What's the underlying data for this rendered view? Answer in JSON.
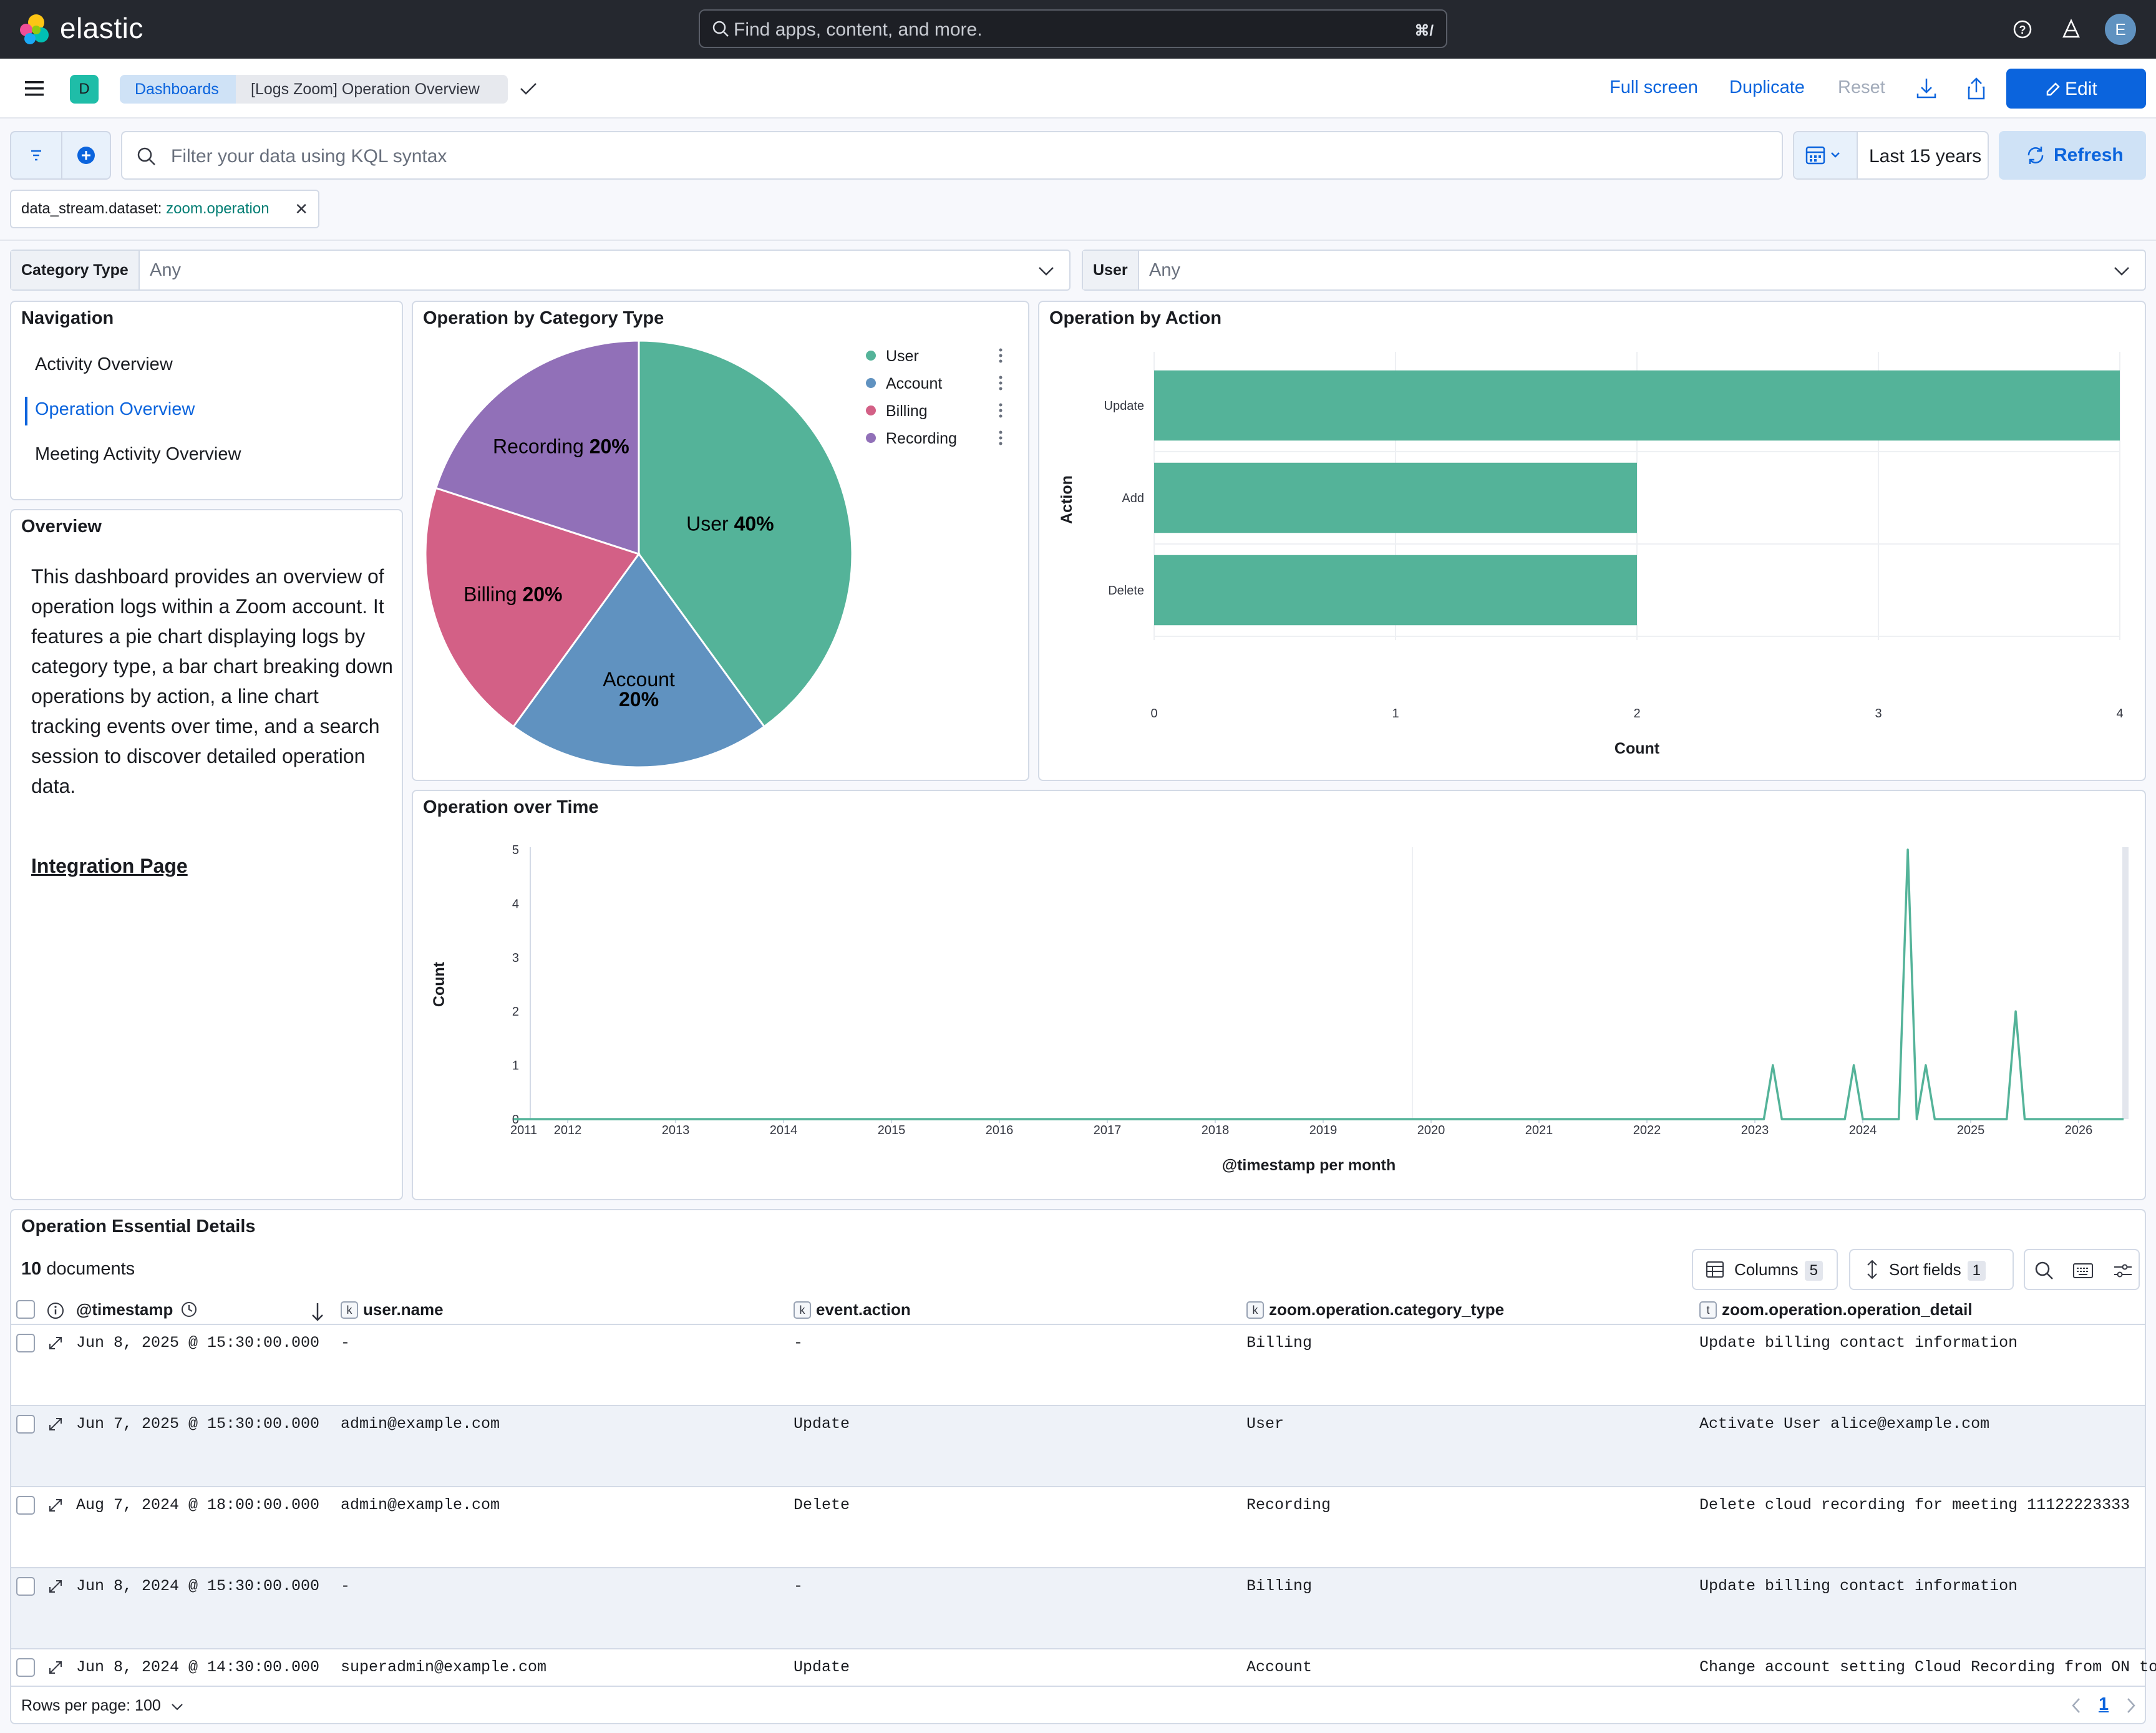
{
  "app": {
    "brand": "elastic",
    "search_placeholder": "Find apps, content, and more.",
    "search_shortcut": "⌘/",
    "user_initial": "E"
  },
  "header": {
    "space_initial": "D",
    "breadcrumbs": [
      "Dashboards",
      "[Logs Zoom] Operation Overview"
    ],
    "actions": {
      "full_screen": "Full screen",
      "duplicate": "Duplicate",
      "reset": "Reset",
      "edit": "Edit"
    }
  },
  "query": {
    "placeholder": "Filter your data using KQL syntax",
    "date_range": "Last 15 years",
    "refresh": "Refresh",
    "filter_pill": {
      "field": "data_stream.dataset:",
      "value": "zoom.operation"
    }
  },
  "controls": [
    {
      "label": "Category Type",
      "value": "Any"
    },
    {
      "label": "User",
      "value": "Any"
    }
  ],
  "navigation": {
    "title": "Navigation",
    "links": [
      "Activity Overview",
      "Operation Overview",
      "Meeting Activity Overview"
    ],
    "active_index": 1
  },
  "overview": {
    "title": "Overview",
    "text": "This dashboard provides an overview of operation logs within a Zoom account. It features a pie chart displaying logs by category type, a bar chart breaking down operations by action, a line chart tracking events over time, and a search session to discover detailed operation data.",
    "link": "Integration Page"
  },
  "colors": {
    "accent": "#0b64dd",
    "green": "#54b399",
    "blue": "#6092c0",
    "pink": "#d36086",
    "purple": "#9170b8"
  },
  "chart_data": [
    {
      "type": "pie",
      "title": "Operation by Category Type",
      "slices": [
        {
          "label": "User",
          "value": 40,
          "color": "#54b399"
        },
        {
          "label": "Account",
          "value": 20,
          "color": "#6092c0"
        },
        {
          "label": "Billing",
          "value": 20,
          "color": "#d36086"
        },
        {
          "label": "Recording",
          "value": 20,
          "color": "#9170b8"
        }
      ],
      "legend": [
        "User",
        "Account",
        "Billing",
        "Recording"
      ]
    },
    {
      "type": "bar",
      "orientation": "horizontal",
      "title": "Operation by Action",
      "categories": [
        "Update",
        "Add",
        "Delete"
      ],
      "values": [
        4,
        2,
        2
      ],
      "xlabel": "Count",
      "ylabel": "Action",
      "xlim": [
        0,
        4
      ],
      "xticks": [
        "0",
        "1",
        "2",
        "3",
        "4"
      ]
    },
    {
      "type": "line",
      "title": "Operation over Time",
      "xlabel": "@timestamp per month",
      "ylabel": "Count",
      "ylim": [
        0,
        5
      ],
      "yticks": [
        "0",
        "1",
        "2",
        "3",
        "4",
        "5"
      ],
      "xticks": [
        "2011",
        "2012",
        "2013",
        "2014",
        "2015",
        "2016",
        "2017",
        "2018",
        "2019",
        "2020",
        "2021",
        "2022",
        "2023",
        "2024",
        "2025",
        "2026"
      ],
      "points": [
        {
          "x": "2011-07",
          "y": 0
        },
        {
          "x": "2023-02",
          "y": 0
        },
        {
          "x": "2023-03",
          "y": 1
        },
        {
          "x": "2023-04",
          "y": 0
        },
        {
          "x": "2023-11",
          "y": 0
        },
        {
          "x": "2023-12",
          "y": 1
        },
        {
          "x": "2024-01",
          "y": 0
        },
        {
          "x": "2024-05",
          "y": 0
        },
        {
          "x": "2024-06",
          "y": 5
        },
        {
          "x": "2024-07",
          "y": 0
        },
        {
          "x": "2024-08",
          "y": 1
        },
        {
          "x": "2024-09",
          "y": 0
        },
        {
          "x": "2025-05",
          "y": 0
        },
        {
          "x": "2025-06",
          "y": 2
        },
        {
          "x": "2025-07",
          "y": 0
        },
        {
          "x": "2026-06",
          "y": 0
        }
      ]
    }
  ],
  "table": {
    "title": "Operation Essential Details",
    "doc_count": "10",
    "doc_label": "documents",
    "columns_btn": "Columns",
    "columns_count": "5",
    "sort_btn": "Sort fields",
    "sort_count": "1",
    "headers": [
      "@timestamp",
      "user.name",
      "event.action",
      "zoom.operation.category_type",
      "zoom.operation.operation_detail"
    ],
    "header_types": [
      "",
      "k",
      "k",
      "k",
      "t"
    ],
    "rows": [
      [
        "Jun 8, 2025 @ 15:30:00.000",
        " -",
        " -",
        "Billing",
        "Update billing contact information"
      ],
      [
        "Jun 7, 2025 @ 15:30:00.000",
        "admin@example.com",
        "Update",
        "User",
        "Activate User alice@example.com"
      ],
      [
        "Aug 7, 2024 @ 18:00:00.000",
        "admin@example.com",
        "Delete",
        "Recording",
        "Delete cloud recording for meeting 11122223333"
      ],
      [
        "Jun 8, 2024 @ 15:30:00.000",
        " -",
        " -",
        "Billing",
        "Update billing contact information"
      ],
      [
        "Jun 8, 2024 @ 14:30:00.000",
        "superadmin@example.com",
        "Update",
        "Account",
        "Change account setting Cloud Recording from ON to"
      ]
    ],
    "rows_per_page": "Rows per page: 100",
    "page": "1"
  }
}
